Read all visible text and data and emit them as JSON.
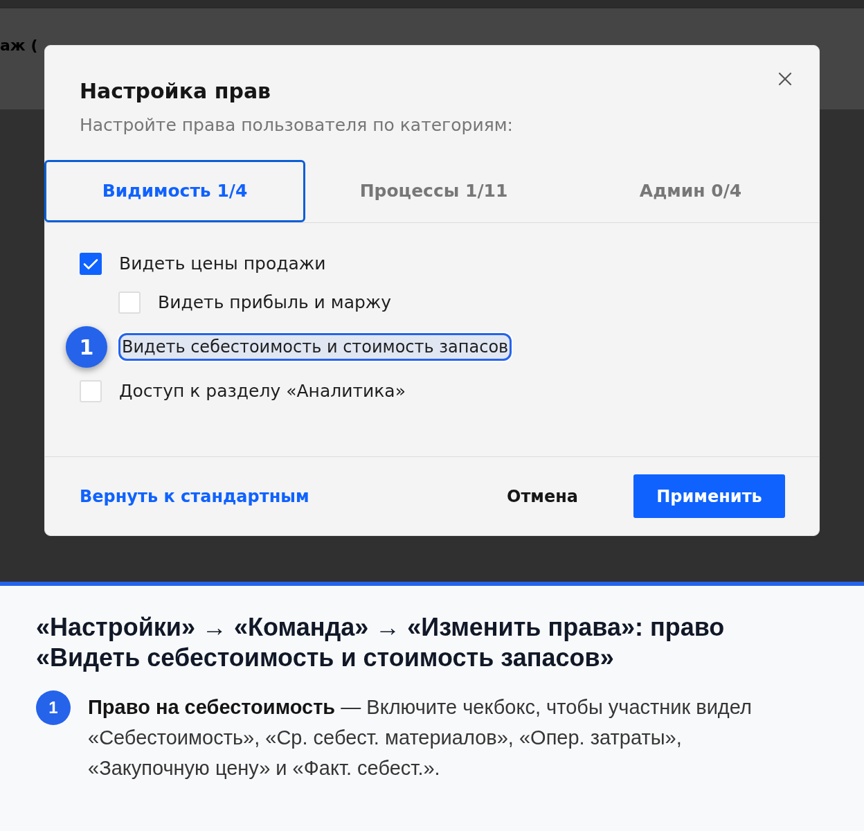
{
  "background": {
    "header_text": "аж ("
  },
  "dialog": {
    "title": "Настройка прав",
    "subtitle": "Настройте права пользователя по категориям:",
    "tabs": [
      {
        "label": "Видимость 1/4",
        "selected": true
      },
      {
        "label": "Процессы 1/11",
        "selected": false
      },
      {
        "label": "Админ 0/4",
        "selected": false
      }
    ],
    "permissions": [
      {
        "kind": "checkbox",
        "label": "Видеть цены продажи",
        "checked": true,
        "children": [
          {
            "kind": "checkbox",
            "label": "Видеть прибыль и маржу",
            "checked": false
          }
        ]
      },
      {
        "kind": "annotated",
        "label": "Видеть себестоимость и стоимость запасов",
        "marker": "1"
      },
      {
        "kind": "checkbox",
        "label": "Доступ к разделу «Аналитика»",
        "checked": false
      }
    ],
    "reset_link": "Вернуть к стандартным",
    "cancel_button": "Отмена",
    "apply_button": "Применить"
  },
  "annotation": {
    "heading": "«Настройки» → «Команда» → «Изменить права»: право «Видеть себестоимость и стоимость запасов»",
    "notes": [
      {
        "marker": "1",
        "text": "**Право на себестоимость** — Включите чекбокс, чтобы участник видел «Себестоимость», «Ср. себест. материалов», «Опер. затраты», «Закупочную цену» и «Факт. себест.»."
      }
    ]
  }
}
